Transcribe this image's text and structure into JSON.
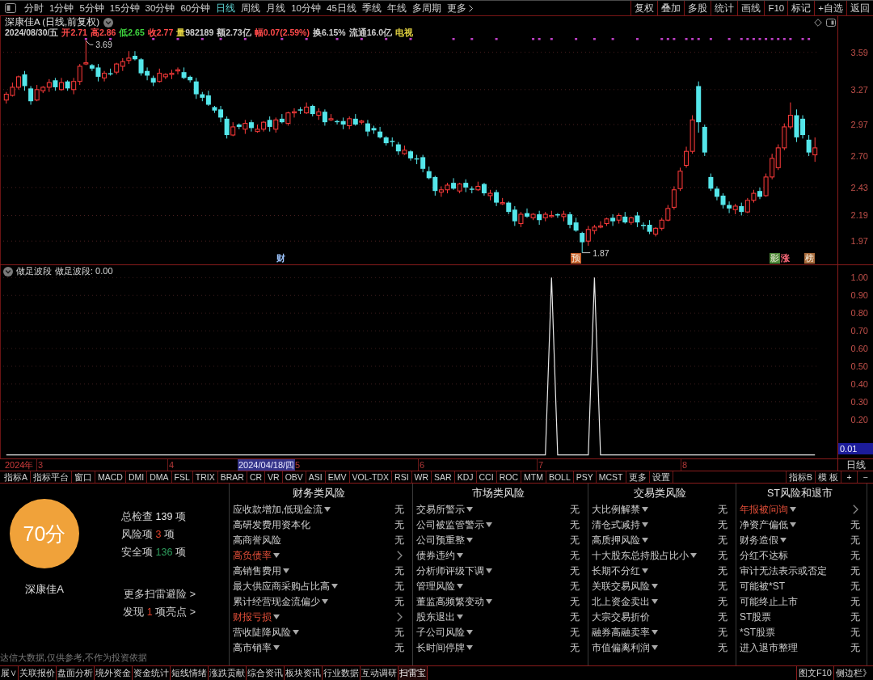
{
  "toolbar": {
    "periods": [
      {
        "label": "分时",
        "kind": "period",
        "selected": false
      },
      {
        "label": "1分钟",
        "kind": "period",
        "selected": false
      },
      {
        "label": "5分钟",
        "kind": "period",
        "selected": false
      },
      {
        "label": "15分钟",
        "kind": "period",
        "selected": false
      },
      {
        "label": "30分钟",
        "kind": "period",
        "selected": false
      },
      {
        "label": "60分钟",
        "kind": "period",
        "selected": false
      },
      {
        "label": "日线",
        "kind": "period",
        "selected": true
      },
      {
        "label": "周线",
        "kind": "period",
        "selected": false
      },
      {
        "label": "月线",
        "kind": "period",
        "selected": false
      },
      {
        "label": "10分钟",
        "kind": "period",
        "selected": false
      },
      {
        "label": "45日线",
        "kind": "period",
        "selected": false
      },
      {
        "label": "季线",
        "kind": "period",
        "selected": false
      },
      {
        "label": "年线",
        "kind": "period",
        "selected": false
      },
      {
        "label": "多周期",
        "kind": "period",
        "selected": false
      },
      {
        "label": "更多",
        "kind": "menu",
        "selected": false
      }
    ],
    "actions": [
      "复权",
      "叠加",
      "多股",
      "统计",
      "画线",
      "F10",
      "标记",
      "+自选",
      "返回"
    ]
  },
  "price_chart": {
    "title": "深康佳A (日线,前复权)",
    "quote": {
      "date": "2024/08/30/五",
      "fields": [
        {
          "kind": "price",
          "label": "开",
          "value": "2.71",
          "color": "#ff4a4a"
        },
        {
          "kind": "price",
          "label": "高",
          "value": "2.86",
          "color": "#ff4a4a"
        },
        {
          "kind": "price",
          "label": "低",
          "value": "2.65",
          "color": "#3ed43e"
        },
        {
          "kind": "price",
          "label": "收",
          "value": "2.77",
          "color": "#ff4a4a"
        },
        {
          "kind": "volume",
          "label": "量",
          "value": "982189",
          "color": "#d0d0d0"
        },
        {
          "kind": "price",
          "label": "额",
          "value": "2.73亿",
          "color": "#d0d0d0"
        },
        {
          "kind": "price",
          "label": "幅",
          "value": "0.07(2.59%)",
          "color": "#ff4a4a"
        },
        {
          "kind": "price",
          "label": "换",
          "value": "6.15%",
          "color": "#d0d0d0"
        },
        {
          "kind": "price",
          "label": "流通",
          "value": "16.0亿",
          "color": "#d0d0d0"
        }
      ],
      "sector": "电视"
    },
    "high_label": "3.69",
    "low_label": "1.87",
    "markers": [
      {
        "text": "财",
        "kind": "plain",
        "color": "#9cc4ff"
      },
      {
        "text": "预",
        "kind": "tag",
        "color": "#c8602a"
      },
      {
        "text": "影",
        "kind": "tag",
        "color": "#4f8a3a"
      },
      {
        "text": "涨",
        "kind": "plain",
        "color": "#ff6a7a"
      },
      {
        "text": "榜",
        "kind": "tag",
        "color": "#a86a3a"
      }
    ],
    "chart_data": {
      "type": "candlestick",
      "grid": true,
      "ylim": [
        1.77,
        3.9
      ],
      "yticks": [
        {
          "value": 3.59,
          "label": "3.59"
        },
        {
          "value": 3.27,
          "label": "3.27"
        },
        {
          "value": 2.97,
          "label": "2.97"
        },
        {
          "value": 2.7,
          "label": "2.70"
        },
        {
          "value": 2.43,
          "label": "2.43"
        },
        {
          "value": 2.19,
          "label": "2.19"
        },
        {
          "value": 1.97,
          "label": "1.97"
        }
      ],
      "ohlc": [
        [
          3.18,
          3.25,
          3.15,
          3.23
        ],
        [
          3.22,
          3.33,
          3.21,
          3.29
        ],
        [
          3.29,
          3.39,
          3.27,
          3.38
        ],
        [
          3.4,
          3.43,
          3.26,
          3.3
        ],
        [
          3.28,
          3.3,
          3.14,
          3.17
        ],
        [
          3.18,
          3.31,
          3.17,
          3.27
        ],
        [
          3.26,
          3.3,
          3.24,
          3.29
        ],
        [
          3.29,
          3.36,
          3.25,
          3.33
        ],
        [
          3.35,
          3.37,
          3.26,
          3.29
        ],
        [
          3.27,
          3.37,
          3.26,
          3.33
        ],
        [
          3.34,
          3.35,
          3.26,
          3.28
        ],
        [
          3.27,
          3.37,
          3.23,
          3.34
        ],
        [
          3.34,
          3.49,
          3.31,
          3.47
        ],
        [
          3.49,
          3.69,
          3.48,
          3.5
        ],
        [
          3.48,
          3.49,
          3.43,
          3.45
        ],
        [
          3.46,
          3.49,
          3.34,
          3.38
        ],
        [
          3.37,
          3.43,
          3.34,
          3.41
        ],
        [
          3.41,
          3.45,
          3.39,
          3.4
        ],
        [
          3.42,
          3.5,
          3.4,
          3.49
        ],
        [
          3.47,
          3.54,
          3.43,
          3.51
        ],
        [
          3.52,
          3.6,
          3.49,
          3.54
        ],
        [
          3.56,
          3.6,
          3.52,
          3.53
        ],
        [
          3.53,
          3.54,
          3.39,
          3.41
        ],
        [
          3.43,
          3.46,
          3.35,
          3.39
        ],
        [
          3.37,
          3.39,
          3.3,
          3.33
        ],
        [
          3.34,
          3.45,
          3.33,
          3.41
        ],
        [
          3.38,
          3.41,
          3.36,
          3.4
        ],
        [
          3.4,
          3.44,
          3.36,
          3.41
        ],
        [
          3.43,
          3.46,
          3.4,
          3.44
        ],
        [
          3.42,
          3.46,
          3.36,
          3.37
        ],
        [
          3.38,
          3.39,
          3.33,
          3.35
        ],
        [
          3.34,
          3.37,
          3.19,
          3.23
        ],
        [
          3.23,
          3.25,
          3.17,
          3.2
        ],
        [
          3.22,
          3.26,
          3.13,
          3.14
        ],
        [
          3.12,
          3.13,
          3.07,
          3.09
        ],
        [
          3.1,
          3.13,
          2.99,
          3.03
        ],
        [
          3.02,
          3.04,
          2.85,
          2.88
        ],
        [
          2.88,
          2.99,
          2.87,
          2.95
        ],
        [
          2.97,
          2.98,
          2.93,
          2.95
        ],
        [
          2.93,
          3.01,
          2.89,
          2.98
        ],
        [
          2.99,
          3.01,
          2.91,
          2.94
        ],
        [
          2.91,
          2.97,
          2.9,
          2.93
        ],
        [
          2.93,
          3.0,
          2.91,
          2.99
        ],
        [
          3.01,
          3.04,
          2.91,
          2.95
        ],
        [
          2.93,
          3.03,
          2.9,
          3.01
        ],
        [
          3.02,
          3.06,
          2.98,
          2.99
        ],
        [
          2.98,
          3.08,
          2.96,
          3.07
        ],
        [
          3.07,
          3.11,
          3.03,
          3.08
        ],
        [
          3.1,
          3.12,
          3.06,
          3.09
        ],
        [
          3.07,
          3.16,
          3.06,
          3.12
        ],
        [
          3.13,
          3.14,
          3.04,
          3.06
        ],
        [
          3.05,
          3.11,
          3.01,
          3.08
        ],
        [
          3.08,
          3.1,
          2.96,
          2.99
        ],
        [
          3.01,
          3.06,
          3.0,
          3.02
        ],
        [
          3.0,
          3.01,
          2.97,
          2.99
        ],
        [
          3.0,
          3.03,
          2.93,
          2.97
        ],
        [
          2.96,
          3.04,
          2.93,
          3.02
        ],
        [
          3.02,
          3.06,
          2.96,
          2.97
        ],
        [
          2.99,
          3.01,
          2.97,
          3.0
        ],
        [
          2.98,
          3.01,
          2.87,
          2.91
        ],
        [
          2.94,
          2.96,
          2.89,
          2.92
        ],
        [
          2.91,
          2.95,
          2.85,
          2.86
        ],
        [
          2.86,
          2.87,
          2.79,
          2.81
        ],
        [
          2.83,
          2.86,
          2.78,
          2.82
        ],
        [
          2.8,
          2.82,
          2.71,
          2.74
        ],
        [
          2.72,
          2.79,
          2.71,
          2.75
        ],
        [
          2.74,
          2.75,
          2.66,
          2.68
        ],
        [
          2.68,
          2.71,
          2.63,
          2.67
        ],
        [
          2.69,
          2.71,
          2.56,
          2.59
        ],
        [
          2.57,
          2.61,
          2.5,
          2.51
        ],
        [
          2.52,
          2.53,
          2.36,
          2.4
        ],
        [
          2.39,
          2.44,
          2.35,
          2.41
        ],
        [
          2.41,
          2.47,
          2.38,
          2.45
        ],
        [
          2.47,
          2.51,
          2.41,
          2.42
        ],
        [
          2.4,
          2.47,
          2.38,
          2.46
        ],
        [
          2.47,
          2.5,
          2.39,
          2.43
        ],
        [
          2.42,
          2.44,
          2.38,
          2.41
        ],
        [
          2.41,
          2.48,
          2.4,
          2.44
        ],
        [
          2.46,
          2.47,
          2.36,
          2.38
        ],
        [
          2.36,
          2.41,
          2.32,
          2.38
        ],
        [
          2.39,
          2.41,
          2.27,
          2.3
        ],
        [
          2.29,
          2.34,
          2.28,
          2.3
        ],
        [
          2.3,
          2.31,
          2.2,
          2.22
        ],
        [
          2.24,
          2.27,
          2.1,
          2.14
        ],
        [
          2.12,
          2.22,
          2.09,
          2.2
        ],
        [
          2.21,
          2.25,
          2.17,
          2.18
        ],
        [
          2.17,
          2.21,
          2.15,
          2.2
        ],
        [
          2.2,
          2.23,
          2.11,
          2.15
        ],
        [
          2.17,
          2.22,
          2.14,
          2.2
        ],
        [
          2.18,
          2.23,
          2.17,
          2.19
        ],
        [
          2.2,
          2.21,
          2.17,
          2.19
        ],
        [
          2.18,
          2.23,
          2.14,
          2.2
        ],
        [
          2.2,
          2.22,
          2.08,
          2.11
        ],
        [
          2.13,
          2.17,
          2.05,
          2.06
        ],
        [
          2.04,
          2.05,
          1.87,
          1.96
        ],
        [
          1.97,
          2.1,
          1.93,
          2.07
        ],
        [
          2.06,
          2.11,
          2.03,
          2.09
        ],
        [
          2.09,
          2.14,
          2.08,
          2.1
        ],
        [
          2.12,
          2.17,
          2.1,
          2.16
        ],
        [
          2.17,
          2.2,
          2.1,
          2.14
        ],
        [
          2.15,
          2.21,
          2.12,
          2.19
        ],
        [
          2.18,
          2.22,
          2.12,
          2.13
        ],
        [
          2.13,
          2.18,
          2.11,
          2.17
        ],
        [
          2.19,
          2.22,
          2.09,
          2.13
        ],
        [
          2.11,
          2.13,
          2.07,
          2.1
        ],
        [
          2.11,
          2.15,
          2.03,
          2.05
        ],
        [
          2.03,
          2.09,
          2.01,
          2.08
        ],
        [
          2.08,
          2.17,
          2.06,
          2.15
        ],
        [
          2.15,
          2.28,
          2.14,
          2.25
        ],
        [
          2.26,
          2.44,
          2.24,
          2.41
        ],
        [
          2.42,
          2.6,
          2.4,
          2.57
        ],
        [
          2.62,
          2.78,
          2.6,
          2.74
        ],
        [
          2.74,
          3.05,
          2.72,
          3.01
        ],
        [
          3.3,
          3.34,
          2.9,
          2.99
        ],
        [
          2.95,
          2.97,
          2.7,
          2.73
        ],
        [
          2.52,
          2.55,
          2.4,
          2.42
        ],
        [
          2.42,
          2.44,
          2.32,
          2.35
        ],
        [
          2.36,
          2.38,
          2.25,
          2.28
        ],
        [
          2.28,
          2.31,
          2.21,
          2.25
        ],
        [
          2.24,
          2.29,
          2.2,
          2.27
        ],
        [
          2.27,
          2.3,
          2.19,
          2.22
        ],
        [
          2.22,
          2.34,
          2.21,
          2.32
        ],
        [
          2.32,
          2.41,
          2.3,
          2.38
        ],
        [
          2.4,
          2.43,
          2.33,
          2.35
        ],
        [
          2.36,
          2.55,
          2.35,
          2.52
        ],
        [
          2.52,
          2.72,
          2.5,
          2.68
        ],
        [
          2.6,
          2.8,
          2.58,
          2.77
        ],
        [
          2.77,
          2.98,
          2.75,
          2.95
        ],
        [
          2.95,
          3.16,
          2.93,
          3.05
        ],
        [
          3.05,
          3.1,
          2.82,
          2.86
        ],
        [
          3.02,
          3.05,
          2.85,
          2.88
        ],
        [
          2.84,
          2.88,
          2.7,
          2.73
        ],
        [
          2.71,
          2.86,
          2.65,
          2.77
        ]
      ]
    }
  },
  "indicator_panel": {
    "readout": "做足波段: 0.00",
    "cursor_value": "0.01",
    "chart_data": {
      "type": "line",
      "title": "做足波段",
      "grid": true,
      "ylim": [
        -0.02,
        1.07
      ],
      "yticks": [
        {
          "value": 1,
          "label": "1.00"
        },
        {
          "value": 0.9,
          "label": "0.90"
        },
        {
          "value": 0.8,
          "label": "0.80"
        },
        {
          "value": 0.7,
          "label": "0.70"
        },
        {
          "value": 0.6,
          "label": "0.60"
        },
        {
          "value": 0.5,
          "label": "0.50"
        },
        {
          "value": 0.4,
          "label": "0.40"
        },
        {
          "value": 0.3,
          "label": "0.30"
        },
        {
          "value": 0.2,
          "label": "0.20"
        }
      ],
      "values": [
        0,
        0,
        0,
        0,
        0,
        0,
        0,
        0,
        0,
        0,
        0,
        0,
        0,
        0,
        0,
        0,
        0,
        0,
        0,
        0,
        0,
        0,
        0,
        0,
        0,
        0,
        0,
        0,
        0,
        0,
        0,
        0,
        0,
        0,
        0,
        0,
        0,
        0,
        0,
        0,
        0,
        0,
        0,
        0,
        0,
        0,
        0,
        0,
        0,
        0,
        0,
        0,
        0,
        0,
        0,
        0,
        0,
        0,
        0,
        0,
        0,
        0,
        0,
        0,
        0,
        0,
        0,
        0,
        0,
        0,
        0,
        0,
        0,
        0,
        0,
        0,
        0,
        0,
        0,
        0,
        0,
        0,
        0,
        0,
        0,
        0,
        0,
        0,
        0,
        1,
        0,
        0,
        0,
        0,
        0,
        0,
        1,
        0,
        0,
        0,
        0,
        0,
        0,
        0,
        0,
        0,
        0,
        0,
        0,
        0,
        0,
        0,
        0,
        0,
        0,
        0,
        0,
        0,
        0,
        0,
        0,
        0,
        0,
        0,
        0,
        0,
        0,
        0,
        0,
        0,
        0,
        0,
        0
      ]
    }
  },
  "date_axis": {
    "year": "2024年",
    "months": [
      "3",
      "4",
      "5",
      "6",
      "7",
      "8"
    ],
    "cursor_date": "2024/04/18/四",
    "period": "日线"
  },
  "indicator_tabs": {
    "left": [
      "指标A",
      "指标平台",
      "窗口",
      "MACD",
      "DMI",
      "DMA",
      "FSL",
      "TRIX",
      "BRAR",
      "CR",
      "VR",
      "OBV",
      "ASI",
      "EMV",
      "VOL-TDX",
      "RSI",
      "WR",
      "SAR",
      "KDJ",
      "CCI",
      "ROC",
      "MTM",
      "BOLL",
      "PSY",
      "MCST",
      "更多",
      "设置"
    ],
    "right": [
      "指标B",
      "模 板",
      "+",
      "−"
    ]
  },
  "risk_panel": {
    "score": "70分",
    "stock": "深康佳A",
    "stats": [
      {
        "label": "总检查",
        "count": "139",
        "unit": "项",
        "color": "#ececec"
      },
      {
        "label": "风险项",
        "count": "3",
        "unit": "项",
        "color": "#e0402a"
      },
      {
        "label": "安全项",
        "count": "136",
        "unit": "项",
        "color": "#2e9e5e"
      }
    ],
    "links": [
      {
        "kind": "plain",
        "text": "更多扫雷避险 >"
      },
      {
        "kind": "count",
        "before": "发现 ",
        "count": "1",
        "after": " 项亮点 >"
      }
    ],
    "disclaimer": "达信大数据,仅供参考,不作为投资依据",
    "columns": [
      {
        "title": "财务类风险",
        "rows": [
          {
            "name": "应收款增加,低现金流",
            "menu": true,
            "risk": false,
            "status": "无"
          },
          {
            "name": "高研发费用资本化",
            "menu": false,
            "risk": false,
            "status": "无"
          },
          {
            "name": "高商誉风险",
            "menu": false,
            "risk": false,
            "status": "无"
          },
          {
            "name": "高负债率",
            "menu": true,
            "risk": true
          },
          {
            "name": "高销售费用",
            "menu": true,
            "risk": false,
            "status": "无"
          },
          {
            "name": "最大供应商采购占比高",
            "menu": true,
            "risk": false,
            "status": "无"
          },
          {
            "name": "累计经营现金流偏少",
            "menu": true,
            "risk": false,
            "status": "无"
          },
          {
            "name": "财报亏损",
            "menu": true,
            "risk": true
          },
          {
            "name": "营收陡降风险",
            "menu": true,
            "risk": false,
            "status": "无"
          },
          {
            "name": "高市销率",
            "menu": true,
            "risk": false,
            "status": "无"
          }
        ]
      },
      {
        "title": "市场类风险",
        "rows": [
          {
            "name": "交易所警示",
            "menu": true,
            "risk": false,
            "status": "无"
          },
          {
            "name": "公司被监管警示",
            "menu": true,
            "risk": false,
            "status": "无"
          },
          {
            "name": "公司预重整",
            "menu": true,
            "risk": false,
            "status": "无"
          },
          {
            "name": "债券违约",
            "menu": true,
            "risk": false,
            "status": "无"
          },
          {
            "name": "分析师评级下调",
            "menu": true,
            "risk": false,
            "status": "无"
          },
          {
            "name": "管理风险",
            "menu": true,
            "risk": false,
            "status": "无"
          },
          {
            "name": "董监高频繁变动",
            "menu": true,
            "risk": false,
            "status": "无"
          },
          {
            "name": "股东退出",
            "menu": true,
            "risk": false,
            "status": "无"
          },
          {
            "name": "子公司风险",
            "menu": true,
            "risk": false,
            "status": "无"
          },
          {
            "name": "长时间停牌",
            "menu": true,
            "risk": false,
            "status": "无"
          }
        ]
      },
      {
        "title": "交易类风险",
        "rows": [
          {
            "name": "大比例解禁",
            "menu": true,
            "risk": false,
            "status": "无"
          },
          {
            "name": "清仓式减持",
            "menu": true,
            "risk": false,
            "status": "无"
          },
          {
            "name": "高质押风险",
            "menu": true,
            "risk": false,
            "status": "无"
          },
          {
            "name": "十大股东总持股占比小",
            "menu": true,
            "risk": false,
            "status": "无"
          },
          {
            "name": "长期不分红",
            "menu": true,
            "risk": false,
            "status": "无"
          },
          {
            "name": "关联交易风险",
            "menu": true,
            "risk": false,
            "status": "无"
          },
          {
            "name": "北上资金卖出",
            "menu": true,
            "risk": false,
            "status": "无"
          },
          {
            "name": "大宗交易折价",
            "menu": false,
            "risk": false,
            "status": "无"
          },
          {
            "name": "融券高融卖率",
            "menu": true,
            "risk": false,
            "status": "无"
          },
          {
            "name": "市值偏离利润",
            "menu": true,
            "risk": false,
            "status": "无"
          }
        ]
      },
      {
        "title": "ST风险和退市",
        "rows": [
          {
            "name": "年报被问询",
            "menu": true,
            "risk": true
          },
          {
            "name": "净资产偏低",
            "menu": true,
            "risk": false,
            "status": "无"
          },
          {
            "name": "财务造假",
            "menu": true,
            "risk": false,
            "status": "无"
          },
          {
            "name": "分红不达标",
            "menu": false,
            "risk": false,
            "status": "无"
          },
          {
            "name": "审计无法表示或否定",
            "menu": false,
            "risk": false,
            "status": "无"
          },
          {
            "name": "可能被*ST",
            "menu": false,
            "risk": false,
            "status": "无"
          },
          {
            "name": "可能终止上市",
            "menu": false,
            "risk": false,
            "status": "无"
          },
          {
            "name": "ST股票",
            "menu": false,
            "risk": false,
            "status": "无"
          },
          {
            "name": "*ST股票",
            "menu": false,
            "risk": false,
            "status": "无"
          },
          {
            "name": "进入退市整理",
            "menu": false,
            "risk": false,
            "status": "无"
          }
        ]
      }
    ]
  },
  "bottom_tabs": {
    "left": [
      {
        "label": "展∨",
        "selected": false
      },
      {
        "label": "关联报价",
        "selected": false
      },
      {
        "label": "盘面分析",
        "selected": false
      },
      {
        "label": "境外资金",
        "selected": false
      },
      {
        "label": "资金统计",
        "selected": false
      },
      {
        "label": "短线情绪",
        "selected": false
      },
      {
        "label": "涨跌贡献",
        "selected": false
      },
      {
        "label": "综合资讯",
        "selected": false
      },
      {
        "label": "板块资讯",
        "selected": false
      },
      {
        "label": "行业数据",
        "selected": false
      },
      {
        "label": "互动调研",
        "selected": false
      },
      {
        "label": "扫雷宝",
        "selected": true
      }
    ],
    "right": [
      "图文F10",
      "侧边栏》"
    ]
  }
}
